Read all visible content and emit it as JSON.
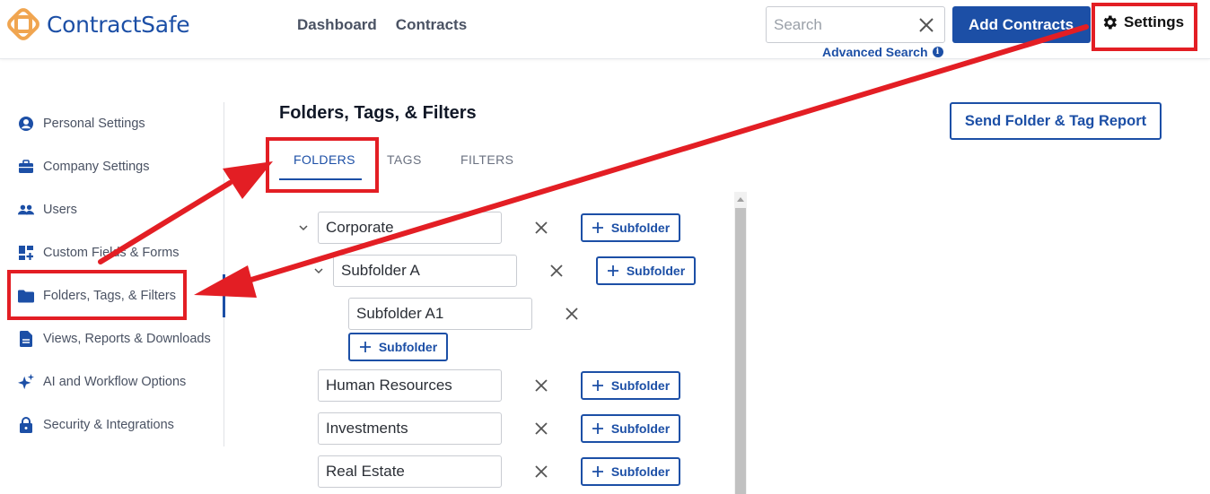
{
  "header": {
    "logo_text": "ContractSafe",
    "nav": [
      "Dashboard",
      "Contracts"
    ],
    "search_placeholder": "Search",
    "advanced_search": "Advanced Search",
    "add_contracts": "Add Contracts",
    "settings": "Settings"
  },
  "sidebar": {
    "items": [
      {
        "label": "Personal Settings",
        "icon": "user-circle-icon"
      },
      {
        "label": "Company Settings",
        "icon": "briefcase-icon"
      },
      {
        "label": "Users",
        "icon": "users-icon"
      },
      {
        "label": "Custom Fields & Forms",
        "icon": "dashboard-icon"
      },
      {
        "label": "Folders, Tags, & Filters",
        "icon": "folder-icon"
      },
      {
        "label": "Views, Reports & Downloads",
        "icon": "document-icon"
      },
      {
        "label": "AI and Workflow Options",
        "icon": "sparkle-icon"
      },
      {
        "label": "Security & Integrations",
        "icon": "lock-icon"
      }
    ],
    "active_index": 4
  },
  "main": {
    "title": "Folders, Tags, & Filters",
    "report_button": "Send Folder & Tag Report",
    "tabs": [
      "FOLDERS",
      "TAGS",
      "FILTERS"
    ],
    "active_tab": 0,
    "subfolder_label": "Subfolder",
    "folders": [
      {
        "name": "Corporate"
      },
      {
        "name": "Subfolder A"
      },
      {
        "name": "Subfolder A1"
      },
      {
        "name": "Human Resources"
      },
      {
        "name": "Investments"
      },
      {
        "name": "Real Estate"
      }
    ]
  },
  "colors": {
    "brand": "#1c4fa6",
    "annotation": "#e31e24"
  }
}
